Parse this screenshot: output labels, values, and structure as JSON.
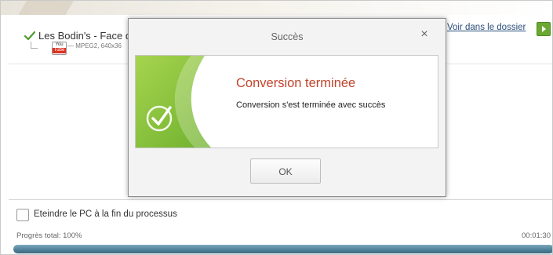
{
  "file": {
    "title": "Les Bodin's - Face d",
    "format": "— MPEG2, 640x36",
    "youtube_icon_top": "You",
    "youtube_icon_bottom": "Tube",
    "folder_link": "Voir dans le dossier"
  },
  "dialog": {
    "title": "Succès",
    "close_glyph": "×",
    "heading": "Conversion terminée",
    "message": "Conversion s'est terminée avec succès",
    "ok_label": "OK"
  },
  "footer": {
    "shutdown_label": "Eteindre le PC à la fin du processus",
    "progress_prefix": "Progrès total: ",
    "progress_text": "100%",
    "progress_value": 1.0,
    "elapsed": "00:01:30"
  },
  "icons": {
    "check": "check-icon",
    "youtube": "youtube-icon",
    "play": "play-icon",
    "success": "success-check-icon"
  },
  "colors": {
    "success_green": "#8cc63f",
    "heading_red": "#c0442b",
    "link_blue": "#2a4d7a",
    "progress_blue": "#4d7f98"
  }
}
